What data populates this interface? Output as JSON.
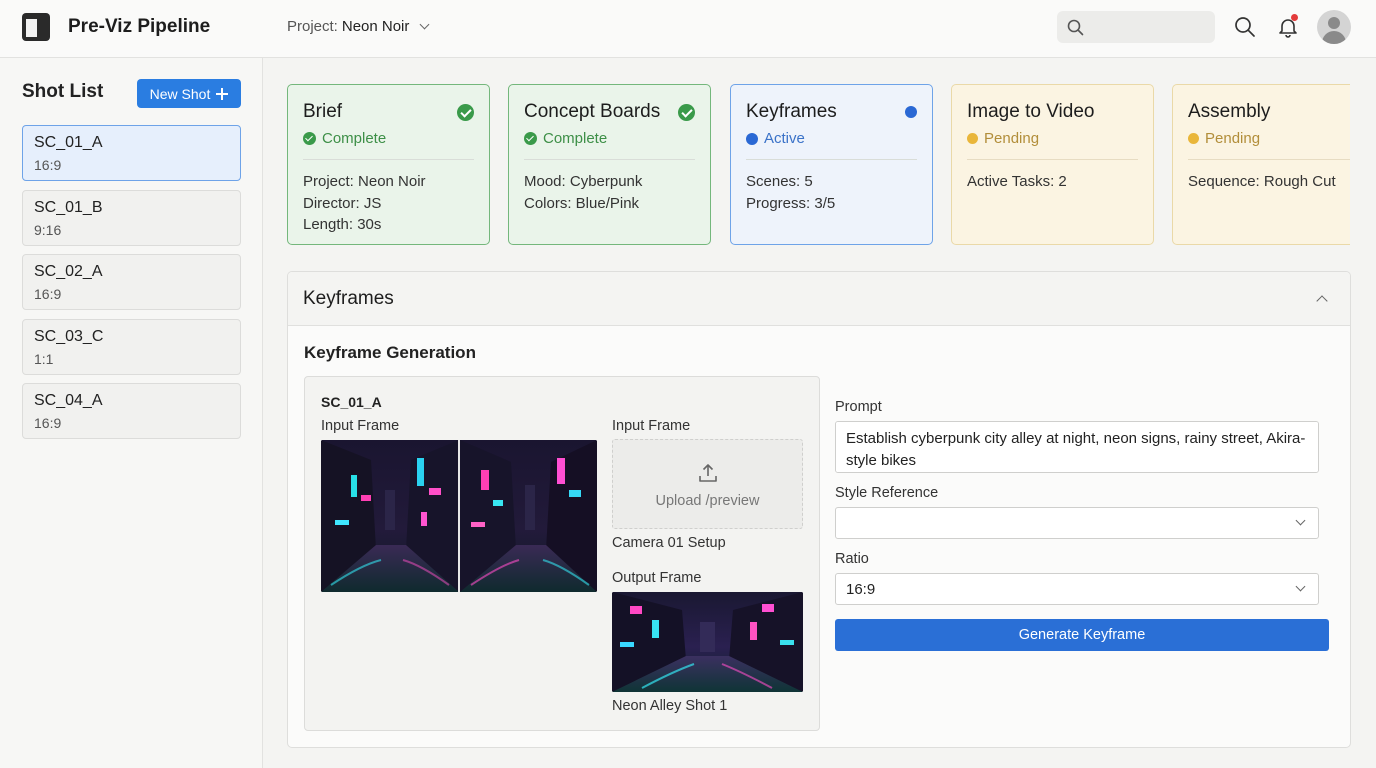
{
  "app": {
    "title": "Pre-Viz Pipeline"
  },
  "topbar": {
    "project_label": "Project:",
    "project_name": "Neon Noir",
    "search_placeholder": ""
  },
  "sidebar": {
    "title": "Shot List",
    "new_shot_label": "New Shot",
    "shots": [
      {
        "code": "SC_01_A",
        "ratio": "16:9",
        "selected": true
      },
      {
        "code": "SC_01_B",
        "ratio": "9:16",
        "selected": false
      },
      {
        "code": "SC_02_A",
        "ratio": "16:9",
        "selected": false
      },
      {
        "code": "SC_03_C",
        "ratio": "1:1",
        "selected": false
      },
      {
        "code": "SC_04_A",
        "ratio": "16:9",
        "selected": false
      }
    ]
  },
  "stages": [
    {
      "title": "Brief",
      "status": "Complete",
      "state": "complete",
      "details": [
        "Project: Neon Noir",
        "Director: JS",
        "Length: 30s"
      ]
    },
    {
      "title": "Concept Boards",
      "status": "Complete",
      "state": "complete",
      "details": [
        "Mood: Cyberpunk",
        "Colors: Blue/Pink"
      ]
    },
    {
      "title": "Keyframes",
      "status": "Active",
      "state": "active",
      "details": [
        "Scenes: 5",
        "Progress: 3/5"
      ]
    },
    {
      "title": "Image to Video",
      "status": "Pending",
      "state": "pending",
      "details": [
        "Active Tasks: 2"
      ]
    },
    {
      "title": "Assembly",
      "status": "Pending",
      "state": "pending",
      "details": [
        "Sequence: Rough Cut"
      ]
    }
  ],
  "panel": {
    "title": "Keyframes",
    "section_title": "Keyframe Generation",
    "shot_code": "SC_01_A",
    "input_frame_label_1": "Input Frame",
    "input_frame_label_2": "Input Frame",
    "upload_text": "Upload /preview",
    "camera_caption": "Camera 01 Setup",
    "output_frame_label": "Output Frame",
    "output_caption": "Neon Alley Shot 1"
  },
  "form": {
    "prompt_label": "Prompt",
    "prompt_value": "Establish cyberpunk city alley at night, neon signs, rainy street, Akira-style bikes",
    "style_label": "Style Reference",
    "style_value": "",
    "ratio_label": "Ratio",
    "ratio_value": "16:9",
    "generate_label": "Generate Keyframe"
  },
  "colors": {
    "accent": "#2a6fd6",
    "complete": "#3a9a4a",
    "active": "#2a68d4",
    "pending": "#e9b63a",
    "notification": "#e33b3b"
  },
  "icons": [
    "app-logo-icon",
    "search-icon",
    "bell-icon",
    "user-avatar-icon",
    "plus-icon",
    "check-circle-icon",
    "upload-icon",
    "chevron-down-icon",
    "chevron-up-icon"
  ]
}
